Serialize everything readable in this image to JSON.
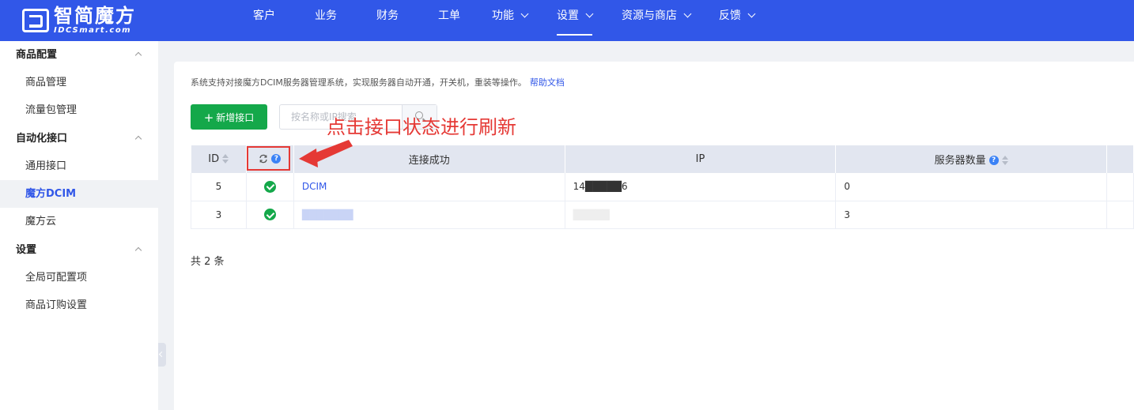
{
  "brand": {
    "name_cn": "智简魔方",
    "name_en": "IDCSmart.com"
  },
  "topnav": [
    {
      "label": "客户",
      "has_dropdown": false,
      "active": false
    },
    {
      "label": "业务",
      "has_dropdown": false,
      "active": false
    },
    {
      "label": "财务",
      "has_dropdown": false,
      "active": false
    },
    {
      "label": "工单",
      "has_dropdown": false,
      "active": false
    },
    {
      "label": "功能",
      "has_dropdown": true,
      "active": false
    },
    {
      "label": "设置",
      "has_dropdown": true,
      "active": true
    },
    {
      "label": "资源与商店",
      "has_dropdown": true,
      "active": false
    },
    {
      "label": "反馈",
      "has_dropdown": true,
      "active": false
    }
  ],
  "sidebar": {
    "groups": [
      {
        "label": "商品配置",
        "items": [
          "商品管理",
          "流量包管理"
        ]
      },
      {
        "label": "自动化接口",
        "items": [
          "通用接口",
          "魔方DCIM",
          "魔方云"
        ]
      },
      {
        "label": "设置",
        "items": [
          "全局可配置项",
          "商品订购设置"
        ]
      }
    ],
    "active_item": "魔方DCIM"
  },
  "main": {
    "description": "系统支持对接魔方DCIM服务器管理系统，实现服务器自动开通，开关机，重装等操作。",
    "help_link": "帮助文档",
    "add_button": "新增接口",
    "search_placeholder": "按名称或IP搜索",
    "annotation": "点击接口状态进行刷新",
    "table": {
      "columns": [
        "ID",
        "",
        "连接成功",
        "IP",
        "服务器数量"
      ],
      "rows": [
        {
          "id": "5",
          "status": "success",
          "name": "DCIM",
          "ip": "14█████6",
          "servers": "0"
        },
        {
          "id": "3",
          "status": "success",
          "name": "███████",
          "ip": "█████",
          "servers": "3"
        }
      ]
    },
    "total": "共 2 条"
  },
  "colors": {
    "primary": "#3157e8",
    "success": "#14a84a",
    "annotation": "#e53935"
  }
}
